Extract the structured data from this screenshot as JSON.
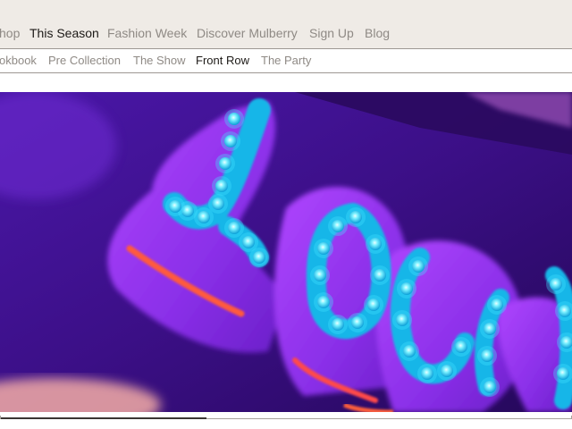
{
  "primary_nav": {
    "items": [
      {
        "label": "hop",
        "active": false
      },
      {
        "label": "This Season",
        "active": true
      },
      {
        "label": "Fashion Week",
        "active": false
      },
      {
        "label": "Discover Mulberry",
        "active": false
      },
      {
        "label": "Sign Up",
        "active": false
      },
      {
        "label": "Blog",
        "active": false
      }
    ]
  },
  "secondary_nav": {
    "items": [
      {
        "label": "okbook",
        "active": false
      },
      {
        "label": "Pre Collection",
        "active": false
      },
      {
        "label": "The Show",
        "active": false
      },
      {
        "label": "Front Row",
        "active": true
      },
      {
        "label": "The Party",
        "active": false
      }
    ]
  },
  "hero": {
    "subject": "neon-sign-lights"
  },
  "scroller": {
    "progress": 0.36
  },
  "colors": {
    "nav_background": "#efebe6",
    "nav_text": "#8f8a85",
    "nav_active_text": "#1d1a17",
    "divider": "#9d9893",
    "neon_purple": "#9b3cf0",
    "neon_cyan": "#1fd6ff"
  }
}
